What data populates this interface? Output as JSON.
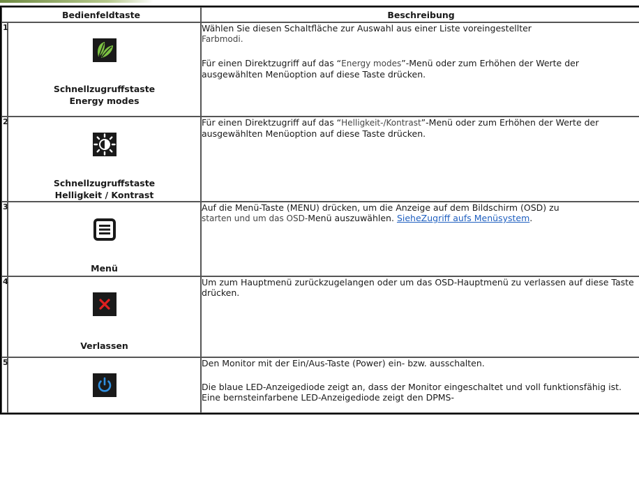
{
  "header": {
    "col_key": "Bedienfeldtaste",
    "col_desc": "Beschreibung"
  },
  "rows": [
    {
      "num": "1",
      "icon": "leaf-icon",
      "label_lines": [
        "Schnellzugruffstaste",
        "Energy modes"
      ],
      "desc": {
        "p1_a": "Wählen Sie diesen Schaltfläche zur Auswahl aus einer Liste voreingestellter",
        "p1_b": "Farbmodi.",
        "p2_a": "Für einen Direktzugriff auf das “",
        "p2_q": "Energy modes",
        "p2_c": "”-Menü oder zum Erhöhen der Werte der ausgewählten Menüoption auf diese Taste drücken."
      }
    },
    {
      "num": "2",
      "icon": "brightness-contrast-icon",
      "label_lines": [
        "Schnellzugruffstaste",
        "Helligkeit / Kontrast"
      ],
      "desc": {
        "p1_a": "Für einen Direktzugriff auf das “",
        "p1_q": "Helligkeit-/Kontrast",
        "p1_c": "”-Menü oder zum Erhöhen der Werte der ausgewählten Menüoption auf diese Taste drücken."
      }
    },
    {
      "num": "3",
      "icon": "menu-icon",
      "label_lines": [
        "Menü"
      ],
      "desc": {
        "p1_a": "Auf die Menü-Taste (MENU) drücken, um die Anzeige auf dem Bildschirm (OSD) zu",
        "p1_b": "starten und um das OSD-",
        "p1_c": "Menü auszuwählen.",
        "p1_link": "SieheZugriff aufs Menüsystem",
        "p1_end": "."
      }
    },
    {
      "num": "4",
      "icon": "close-icon",
      "label_lines": [
        "Verlassen"
      ],
      "desc": {
        "p1_a": "Um zum Hauptmenü zurückzugelangen oder um das OSD-Hauptmenü zu verlassen auf diese Taste drücken."
      }
    },
    {
      "num": "5",
      "icon": "power-icon",
      "label_lines": [],
      "desc": {
        "p1_a": "Den Monitor mit der Ein/Aus-Taste (Power) ein- bzw. ausschalten.",
        "p2_a": "Die blaue LED-Anzeigediode zeigt an, dass der Monitor eingeschaltet und voll funktionsfähig ist. Eine bernsteinfarbene LED-Anzeigediode zeigt den DPMS-"
      }
    }
  ],
  "colors": {
    "leaf_bg": "#1a1a1a",
    "leaf_green": "#7cc242",
    "close_red": "#e02020",
    "power_blue": "#2f8fe0",
    "link": "#2060c0"
  }
}
